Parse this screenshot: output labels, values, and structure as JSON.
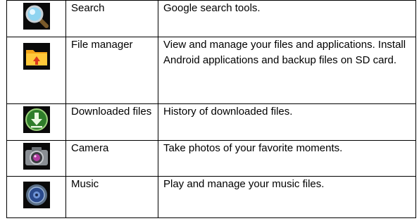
{
  "apps": [
    {
      "icon": "search-magnifier-icon",
      "name": "Search",
      "description": "Google search tools."
    },
    {
      "icon": "folder-icon",
      "name": "File manager",
      "description": "View and manage your files and applications. Install Android applications and backup files on SD card."
    },
    {
      "icon": "download-icon",
      "name": "Downloaded files",
      "description": "History of downloaded files."
    },
    {
      "icon": "camera-icon",
      "name": "Camera",
      "description": "Take photos of your favorite moments."
    },
    {
      "icon": "music-speaker-icon",
      "name": "Music",
      "description": "Play and manage your music files."
    }
  ]
}
